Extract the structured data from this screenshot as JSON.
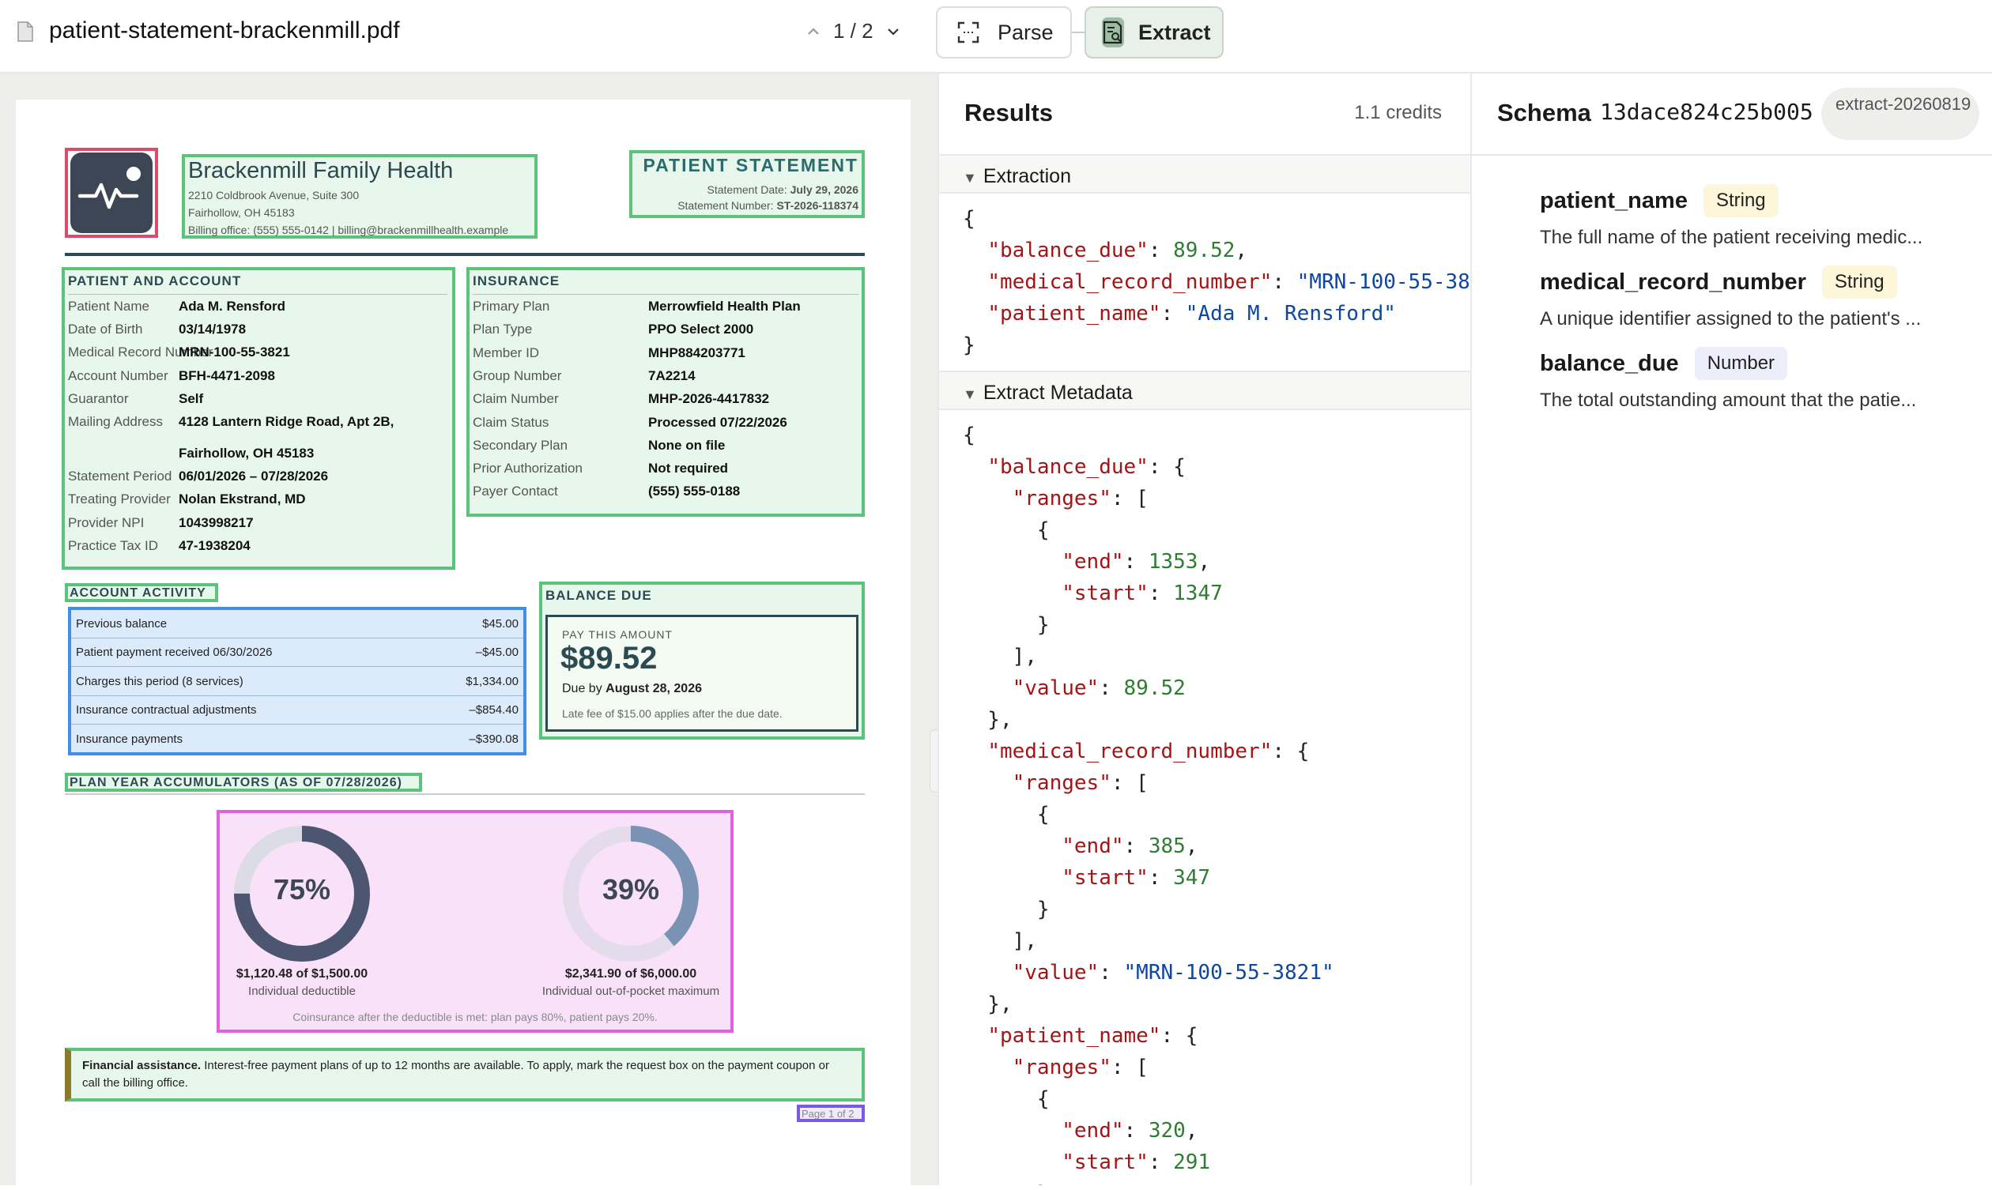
{
  "topbar": {
    "file_name": "patient-statement-brackenmill.pdf",
    "page_indicator": "1 / 2",
    "parse_label": "Parse",
    "extract_label": "Extract"
  },
  "document": {
    "clinic_name": "Brackenmill Family Health",
    "clinic_address1": "2210 Coldbrook Avenue, Suite 300",
    "clinic_address2": "Fairhollow, OH 45183",
    "clinic_contact": "Billing office: (555) 555-0142  |  billing@brackenmillhealth.example",
    "statement_title": "PATIENT STATEMENT",
    "statement_date_label": "Statement Date:",
    "statement_date": "July 29, 2026",
    "statement_number_label": "Statement Number:",
    "statement_number": "ST-2026-118374",
    "patient_section": "PATIENT AND ACCOUNT",
    "patient_rows": [
      {
        "label": "Patient Name",
        "value": "Ada M. Rensford"
      },
      {
        "label": "Date of Birth",
        "value": "03/14/1978"
      },
      {
        "label": "Medical Record Number",
        "value": "MRN-100-55-3821"
      },
      {
        "label": "Account Number",
        "value": "BFH-4471-2098"
      },
      {
        "label": "Guarantor",
        "value": "Self"
      },
      {
        "label": "Mailing Address",
        "value": "4128 Lantern Ridge Road, Apt 2B,",
        "value2": "Fairhollow, OH 45183"
      },
      {
        "label": "Statement Period",
        "value": "06/01/2026 – 07/28/2026"
      },
      {
        "label": "Treating Provider",
        "value": "Nolan Ekstrand, MD"
      },
      {
        "label": "Provider NPI",
        "value": "1043998217"
      },
      {
        "label": "Practice Tax ID",
        "value": "47-1938204"
      }
    ],
    "insurance_section": "INSURANCE",
    "insurance_rows": [
      {
        "label": "Primary Plan",
        "value": "Merrowfield Health Plan"
      },
      {
        "label": "Plan Type",
        "value": "PPO Select 2000"
      },
      {
        "label": "Member ID",
        "value": "MHP884203771"
      },
      {
        "label": "Group Number",
        "value": "7A2214"
      },
      {
        "label": "Claim Number",
        "value": "MHP-2026-4417832"
      },
      {
        "label": "Claim Status",
        "value": "Processed 07/22/2026"
      },
      {
        "label": "Secondary Plan",
        "value": "None on file"
      },
      {
        "label": "Prior Authorization",
        "value": "Not required"
      },
      {
        "label": "Payer Contact",
        "value": "(555) 555-0188"
      }
    ],
    "activity_section": "ACCOUNT ACTIVITY",
    "activity_rows": [
      {
        "label": "Previous balance",
        "value": "$45.00"
      },
      {
        "label": "Patient payment received 06/30/2026",
        "value": "–$45.00"
      },
      {
        "label": "Charges this period (8 services)",
        "value": "$1,334.00"
      },
      {
        "label": "Insurance contractual adjustments",
        "value": "–$854.40"
      },
      {
        "label": "Insurance payments",
        "value": "–$390.08"
      }
    ],
    "balance_section": "BALANCE DUE",
    "pay_label": "PAY THIS AMOUNT",
    "pay_amount": "$89.52",
    "due_label": "Due by",
    "due_date": "August 28, 2026",
    "late_fee": "Late fee of $15.00 applies after the due date.",
    "accum_section": "PLAN YEAR ACCUMULATORS (AS OF 07/28/2026)",
    "accumulators": [
      {
        "pct_label": "75%",
        "fraction": 0.75,
        "amount": "$1,120.48 of $1,500.00",
        "caption": "Individual deductible",
        "color": "#4d5670",
        "track": "#dcdce6"
      },
      {
        "pct_label": "39%",
        "fraction": 0.39,
        "amount": "$2,341.90 of $6,000.00",
        "caption": "Individual out-of-pocket maximum",
        "color": "#7a93b5",
        "track": "#e5dceb"
      }
    ],
    "coinsurance_note": "Coinsurance after the deductible is met: plan pays 80%, patient pays 20%.",
    "assist_bold": "Financial assistance.",
    "assist_text": " Interest-free payment plans of up to 12 months are available. To apply, mark the request box on the payment coupon or call the billing office.",
    "page_footer": "Page 1 of 2"
  },
  "results": {
    "title": "Results",
    "credits": "1.1 credits",
    "extraction_label": "Extraction",
    "metadata_label": "Extract Metadata"
  },
  "extraction": {
    "balance_due": "89.52",
    "medical_record_number": "\"MRN-100-55-38",
    "patient_name": "\"Ada M. Rensford\""
  },
  "metadata": {
    "balance_due": {
      "end": "1353",
      "start": "1347",
      "value": "89.52"
    },
    "medical_record_number": {
      "end": "385",
      "start": "347",
      "value": "\"MRN-100-55-3821\""
    },
    "patient_name": {
      "end": "320",
      "start": "291"
    }
  },
  "schema": {
    "title": "Schema",
    "id": "13dace824c25b005",
    "badge": "extract-20260819",
    "fields": [
      {
        "name": "patient_name",
        "type": "String",
        "desc": "The full name of the patient receiving medic..."
      },
      {
        "name": "medical_record_number",
        "type": "String",
        "desc": "A unique identifier assigned to the patient's ..."
      },
      {
        "name": "balance_due",
        "type": "Number",
        "desc": "The total outstanding amount that the patie..."
      }
    ]
  }
}
